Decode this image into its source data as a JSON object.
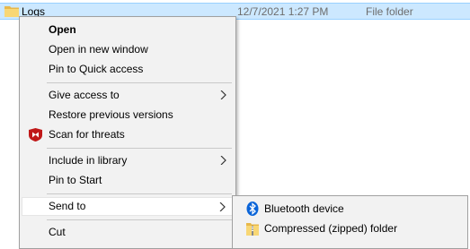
{
  "explorer_row": {
    "name": "Logs",
    "date_modified": "12/7/2021 1:27 PM",
    "type": "File folder",
    "icon": "folder-icon"
  },
  "context_menu": {
    "items": [
      {
        "label": "Open"
      },
      {
        "label": "Open in new window"
      },
      {
        "label": "Pin to Quick access"
      },
      {
        "label": "Give access to",
        "icon": "chevron-right-icon"
      },
      {
        "label": "Restore previous versions"
      },
      {
        "label": "Scan for threats",
        "icon": "mcafee-shield-icon"
      },
      {
        "label": "Include in library",
        "icon": "chevron-right-icon"
      },
      {
        "label": "Pin to Start"
      },
      {
        "label": "Send to",
        "icon": "chevron-right-icon"
      },
      {
        "label": "Cut"
      }
    ]
  },
  "send_to_submenu": {
    "items": [
      {
        "label": "Bluetooth device",
        "icon": "bluetooth-icon"
      },
      {
        "label": "Compressed (zipped) folder",
        "icon": "zip-folder-icon"
      }
    ]
  },
  "colors": {
    "selection_bg": "#cce8ff",
    "menu_bg": "#f2f2f2",
    "bluetooth": "#0a64d8",
    "mcafee": "#c01818"
  }
}
